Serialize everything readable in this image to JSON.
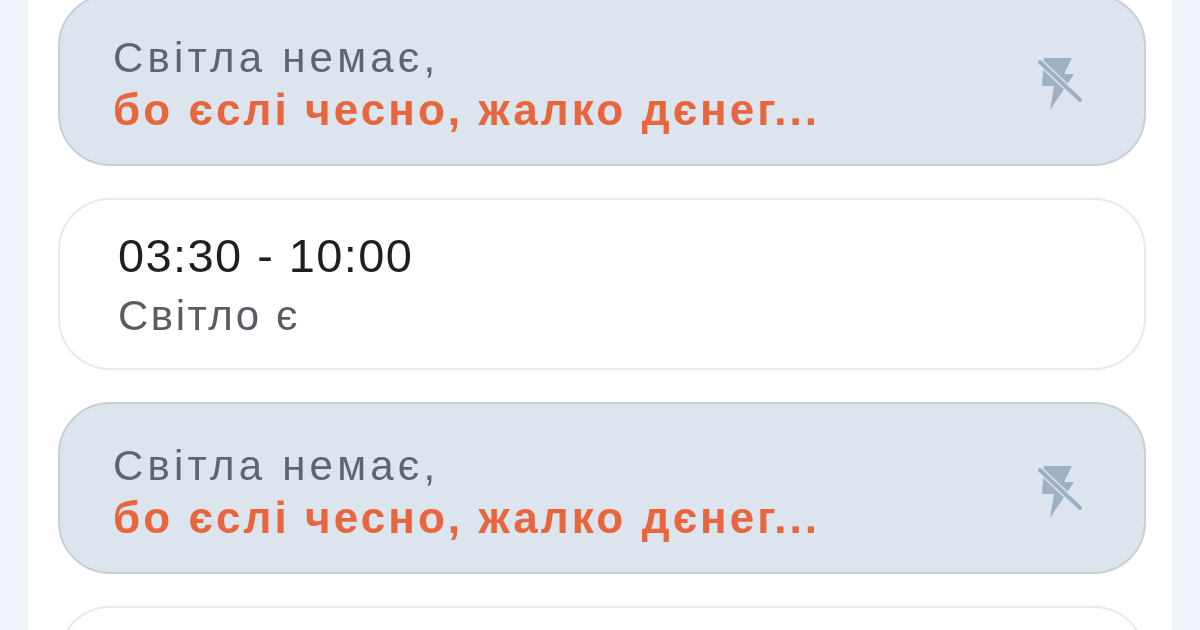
{
  "slots": [
    {
      "kind": "outage",
      "status": "Світла немає,",
      "note": "бо єслі чесно, жалко дєнег..."
    },
    {
      "kind": "power",
      "time": "03:30 - 10:00",
      "status": "Світло є"
    },
    {
      "kind": "outage",
      "status": "Світла немає,",
      "note": "бо єслі чесно, жалко дєнег..."
    },
    {
      "kind": "power"
    }
  ]
}
